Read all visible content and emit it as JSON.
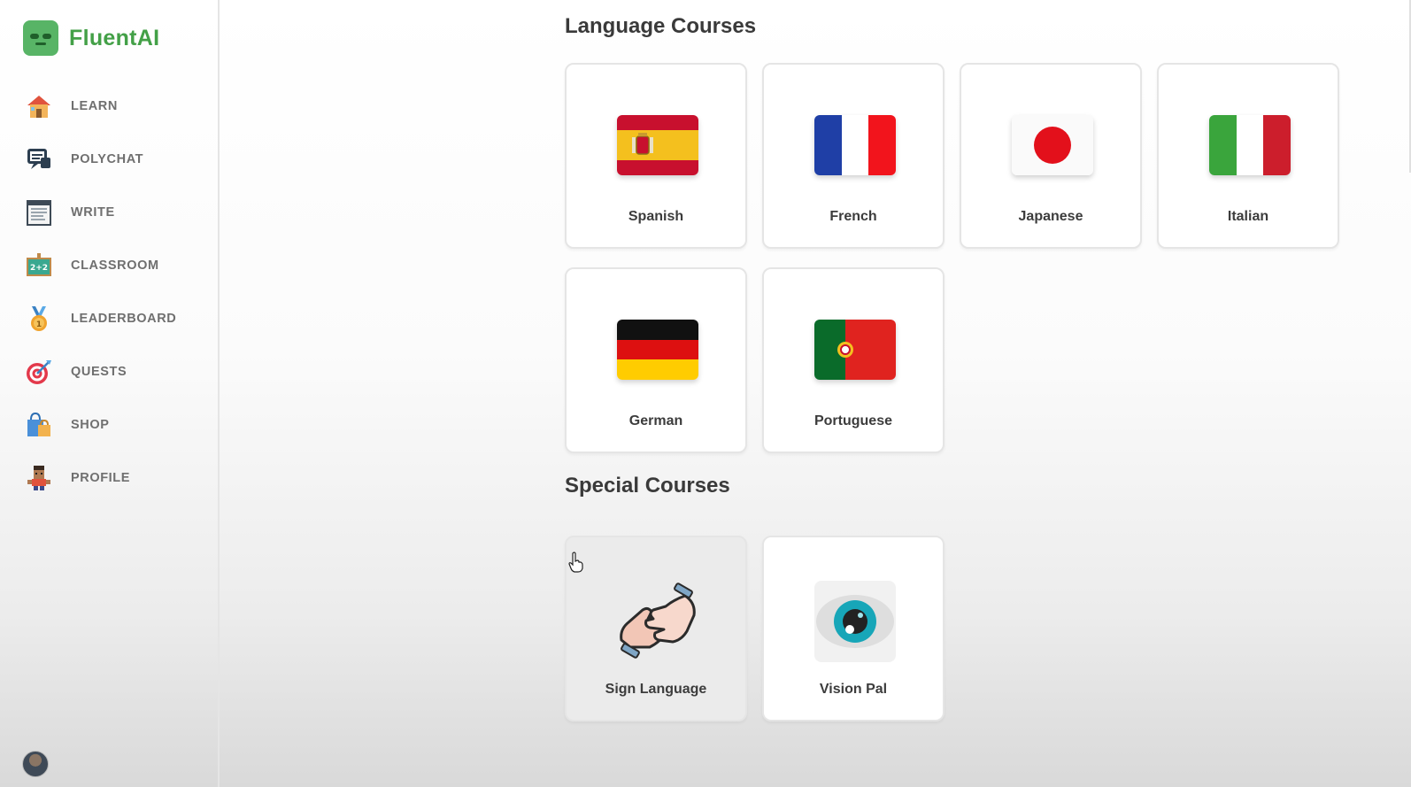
{
  "app": {
    "brand_name": "FluentAI",
    "brand_color": "#43a047"
  },
  "sidebar": {
    "items": [
      {
        "label": "LEARN",
        "icon": "home-icon"
      },
      {
        "label": "POLYCHAT",
        "icon": "chat-icon"
      },
      {
        "label": "WRITE",
        "icon": "notebook-icon"
      },
      {
        "label": "CLASSROOM",
        "icon": "chalkboard-icon"
      },
      {
        "label": "LEADERBOARD",
        "icon": "medal-icon"
      },
      {
        "label": "QUESTS",
        "icon": "target-icon"
      },
      {
        "label": "SHOP",
        "icon": "shopping-bag-icon"
      },
      {
        "label": "PROFILE",
        "icon": "character-icon"
      }
    ]
  },
  "main": {
    "language_title": "Language Courses",
    "languages": [
      {
        "label": "Spanish",
        "flag": "spain-flag-icon"
      },
      {
        "label": "French",
        "flag": "france-flag-icon"
      },
      {
        "label": "Japanese",
        "flag": "japan-flag-icon"
      },
      {
        "label": "Italian",
        "flag": "italy-flag-icon"
      },
      {
        "label": "German",
        "flag": "germany-flag-icon"
      },
      {
        "label": "Portuguese",
        "flag": "portugal-flag-icon"
      }
    ],
    "special_title": "Special Courses",
    "special": [
      {
        "label": "Sign Language",
        "icon": "sign-language-hands-icon"
      },
      {
        "label": "Vision Pal",
        "icon": "eye-icon"
      }
    ]
  }
}
